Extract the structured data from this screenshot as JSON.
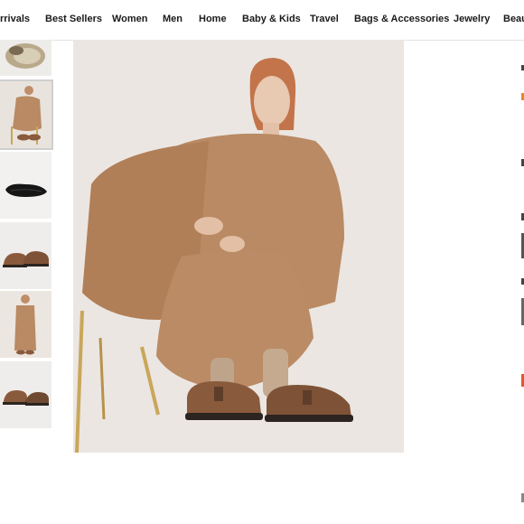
{
  "nav": {
    "items": [
      {
        "label": "rrivals"
      },
      {
        "label": "Best Sellers"
      },
      {
        "label": "Women"
      },
      {
        "label": "Men"
      },
      {
        "label": "Home"
      },
      {
        "label": "Baby & Kids"
      },
      {
        "label": "Travel"
      },
      {
        "label": "Bags & Accessories"
      },
      {
        "label": "Jewelry"
      },
      {
        "label": "Beau"
      }
    ]
  },
  "gallery": {
    "thumbnails": [
      {
        "icon": "clog-top-view-icon"
      },
      {
        "icon": "model-seated-icon",
        "selected": true
      },
      {
        "icon": "clog-sole-icon"
      },
      {
        "icon": "clog-pair-icon"
      },
      {
        "icon": "model-standing-icon"
      },
      {
        "icon": "clog-pair-side-icon"
      }
    ],
    "main_image": {
      "icon": "model-seated-clogs-photo"
    }
  },
  "colors": {
    "camel": "#b98a63",
    "suede": "#8a5a3c",
    "background": "#ebe6e2"
  }
}
